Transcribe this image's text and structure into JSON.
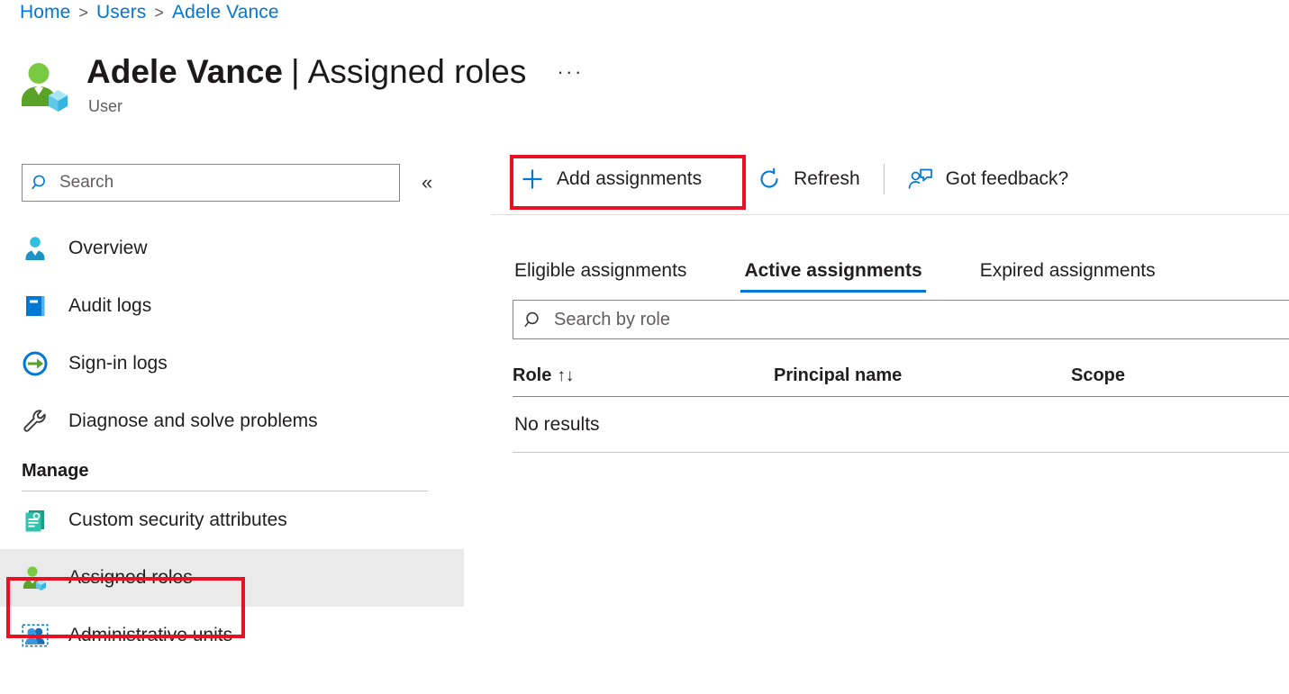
{
  "breadcrumb": {
    "items": [
      "Home",
      "Users",
      "Adele Vance"
    ],
    "separator": ">"
  },
  "header": {
    "title_name": "Adele Vance",
    "title_separator": "|",
    "title_page": "Assigned roles",
    "more_menu": "···",
    "subtitle": "User",
    "icon": "user-with-cube-icon"
  },
  "sidebar": {
    "search": {
      "placeholder": "Search",
      "value": "",
      "icon": "search-icon"
    },
    "collapse": {
      "label": "«",
      "icon": "collapse-chevrons-icon"
    },
    "items": [
      {
        "label": "Overview",
        "icon": "user-overview-icon",
        "selected": false
      },
      {
        "label": "Audit logs",
        "icon": "audit-logs-book-icon",
        "selected": false
      },
      {
        "label": "Sign-in logs",
        "icon": "sign-in-arrow-icon",
        "selected": false
      },
      {
        "label": "Diagnose and solve problems",
        "icon": "wrench-icon",
        "selected": false
      }
    ],
    "group": {
      "title": "Manage",
      "items": [
        {
          "label": "Custom security attributes",
          "icon": "document-gear-icon",
          "selected": false
        },
        {
          "label": "Assigned roles",
          "icon": "assigned-roles-icon",
          "selected": true
        },
        {
          "label": "Administrative units",
          "icon": "administrative-units-icon",
          "selected": false
        }
      ]
    }
  },
  "toolbar": {
    "add_assignments": {
      "label": "Add assignments",
      "icon": "plus-icon"
    },
    "refresh": {
      "label": "Refresh",
      "icon": "refresh-icon"
    },
    "got_feedback": {
      "label": "Got feedback?",
      "icon": "person-feedback-icon"
    }
  },
  "tabs": [
    {
      "label": "Eligible assignments",
      "active": false
    },
    {
      "label": "Active assignments",
      "active": true
    },
    {
      "label": "Expired assignments",
      "active": false
    }
  ],
  "role_search": {
    "placeholder": "Search by role",
    "value": "",
    "icon": "search-icon"
  },
  "table": {
    "columns": [
      "Role",
      "Principal name",
      "Scope"
    ],
    "sort_icon": "↑↓",
    "rows": [],
    "empty_message": "No results"
  },
  "colors": {
    "accent": "#0078d4",
    "annotation": "#e81123",
    "selected_row": "#eaeaea",
    "text": "#201f1e",
    "muted_text": "#605e5c"
  }
}
